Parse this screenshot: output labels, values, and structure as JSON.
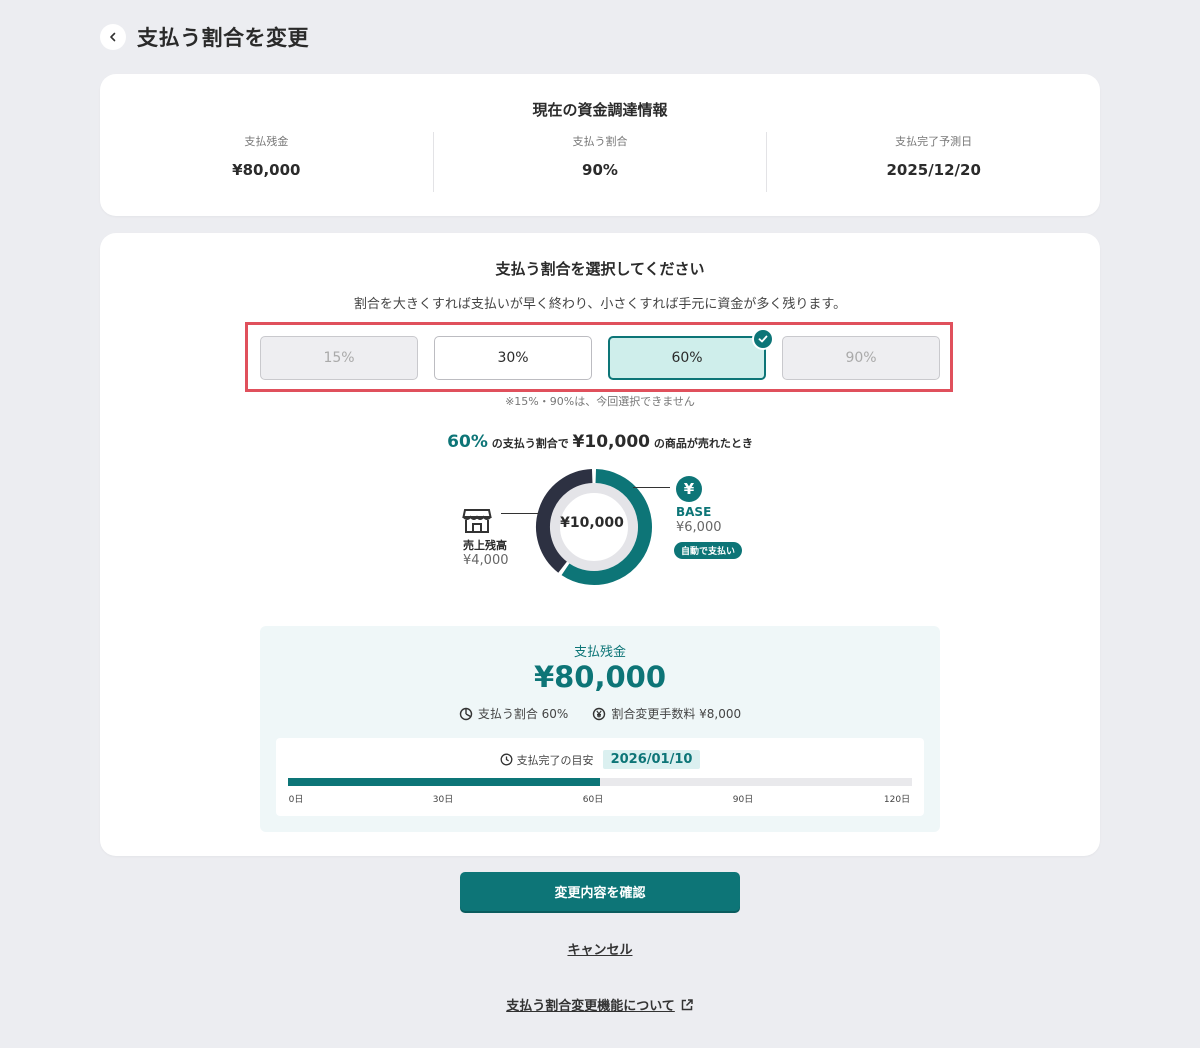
{
  "header": {
    "title": "支払う割合を変更"
  },
  "current_info": {
    "title": "現在の資金調達情報",
    "columns": [
      {
        "label": "支払残金",
        "value": "¥80,000"
      },
      {
        "label": "支払う割合",
        "value": "90%"
      },
      {
        "label": "支払完了予測日",
        "value": "2025/12/20"
      }
    ]
  },
  "selector": {
    "title": "支払う割合を選択してください",
    "description": "割合を大きくすれば支払いが早く終わり、小さくすれば手元に資金が多く残ります。",
    "options": [
      {
        "label": "15%",
        "state": "disabled"
      },
      {
        "label": "30%",
        "state": "normal"
      },
      {
        "label": "60%",
        "state": "selected"
      },
      {
        "label": "90%",
        "state": "disabled"
      }
    ],
    "note": "※15%・90%は、今回選択できません"
  },
  "simulation": {
    "pct": "60%",
    "text_a": "の支払う割合で",
    "amount": "¥10,000",
    "text_b": "の商品が売れたとき",
    "center": "¥10,000",
    "store_label": "売上残高",
    "store_value": "¥4,000",
    "base_label": "BASE",
    "base_value": "¥6,000",
    "auto_badge": "自動で支払い",
    "base_share": 0.6,
    "colors": {
      "base": "#0d7577",
      "store": "#2d3142",
      "inner": "#e4e4e8"
    }
  },
  "summary": {
    "label": "支払残金",
    "value": "¥80,000",
    "rate_text": "支払う割合 60%",
    "fee_text": "割合変更手数料 ¥8,000",
    "timeline_label": "支払完了の目安",
    "timeline_date": "2026/01/10",
    "progress": 0.5,
    "ticks": [
      "0日",
      "30日",
      "60日",
      "90日",
      "120日"
    ]
  },
  "actions": {
    "confirm": "変更内容を確認",
    "cancel": "キャンセル",
    "about": "支払う割合変更機能について"
  },
  "colors": {
    "accent": "#0d7577",
    "highlight": "#e0505c",
    "background": "#ecedf1"
  }
}
